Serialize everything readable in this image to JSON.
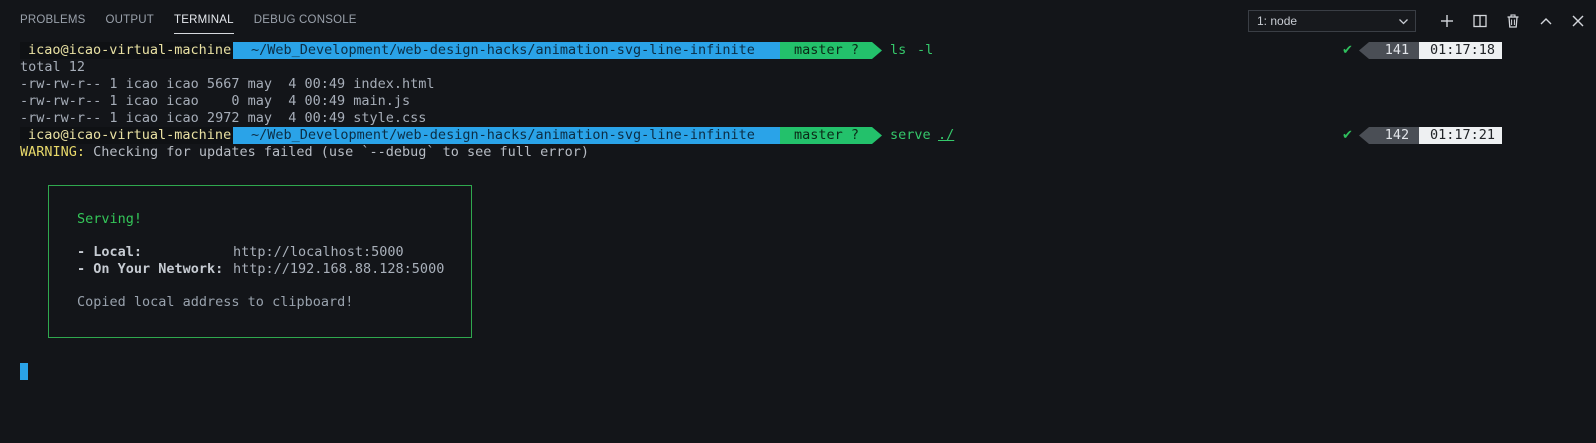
{
  "tabs": [
    {
      "label": "PROBLEMS",
      "active": false
    },
    {
      "label": "OUTPUT",
      "active": false
    },
    {
      "label": "TERMINAL",
      "active": true
    },
    {
      "label": "DEBUG CONSOLE",
      "active": false
    }
  ],
  "terminal_select": {
    "value": "1: node"
  },
  "actions": [
    "add-icon",
    "split-icon",
    "trash-icon",
    "maximize-icon",
    "close-icon"
  ],
  "colors": {
    "background": "#131519",
    "path_segment": "#2aa3e8",
    "git_segment": "#23c16b",
    "user_text": "#e9e1a3",
    "box_border": "#2fa84e"
  },
  "prompts": [
    {
      "user": "icao@icao-virtual-machine",
      "path": "~/Web_Development/web-design-hacks/animation-svg-line-infinite",
      "git": "master ?",
      "command": "ls",
      "arg": "-l",
      "status": "✔",
      "num": "141",
      "time": "01:17:18"
    },
    {
      "user": "icao@icao-virtual-machine",
      "path": "~/Web_Development/web-design-hacks/animation-svg-line-infinite",
      "git": "master ?",
      "command": "serve",
      "arg": "./",
      "status": "✔",
      "num": "142",
      "time": "01:17:21"
    }
  ],
  "ls_output": [
    "total 12",
    "-rw-rw-r-- 1 icao icao 5667 may  4 00:49 index.html",
    "-rw-rw-r-- 1 icao icao    0 may  4 00:49 main.js",
    "-rw-rw-r-- 1 icao icao 2972 may  4 00:49 style.css"
  ],
  "warning": {
    "label": "WARNING:",
    "text": " Checking for updates failed (use `--debug` to see full error)"
  },
  "serve_box": {
    "serving": "Serving!",
    "local_label": "- Local:",
    "local_url": "http://localhost:5000",
    "network_label": "- On Your Network:",
    "network_url": "http://192.168.88.128:5000",
    "copied": "Copied local address to clipboard!"
  }
}
